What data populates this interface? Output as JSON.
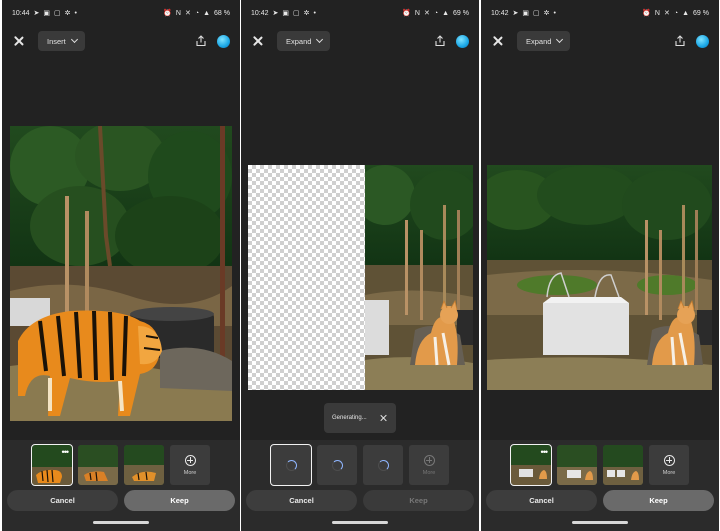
{
  "screens": [
    {
      "status": {
        "time": "10:44",
        "battery": "68 %"
      },
      "mode_label": "Insert",
      "more_label": "More",
      "cancel_label": "Cancel",
      "keep_label": "Keep"
    },
    {
      "status": {
        "time": "10:42",
        "battery": "69 %"
      },
      "mode_label": "Expand",
      "more_label": "More",
      "cancel_label": "Cancel",
      "keep_label": "Keep",
      "toast_text": "Generating..."
    },
    {
      "status": {
        "time": "10:42",
        "battery": "69 %"
      },
      "mode_label": "Expand",
      "more_label": "More",
      "cancel_label": "Cancel",
      "keep_label": "Keep"
    }
  ],
  "icons": {
    "close": "close-icon",
    "share": "share-icon",
    "avatar": "profile-avatar",
    "chevron": "chevron-down-icon",
    "more": "plus-circle-icon",
    "spinner": "loading-spinner"
  }
}
